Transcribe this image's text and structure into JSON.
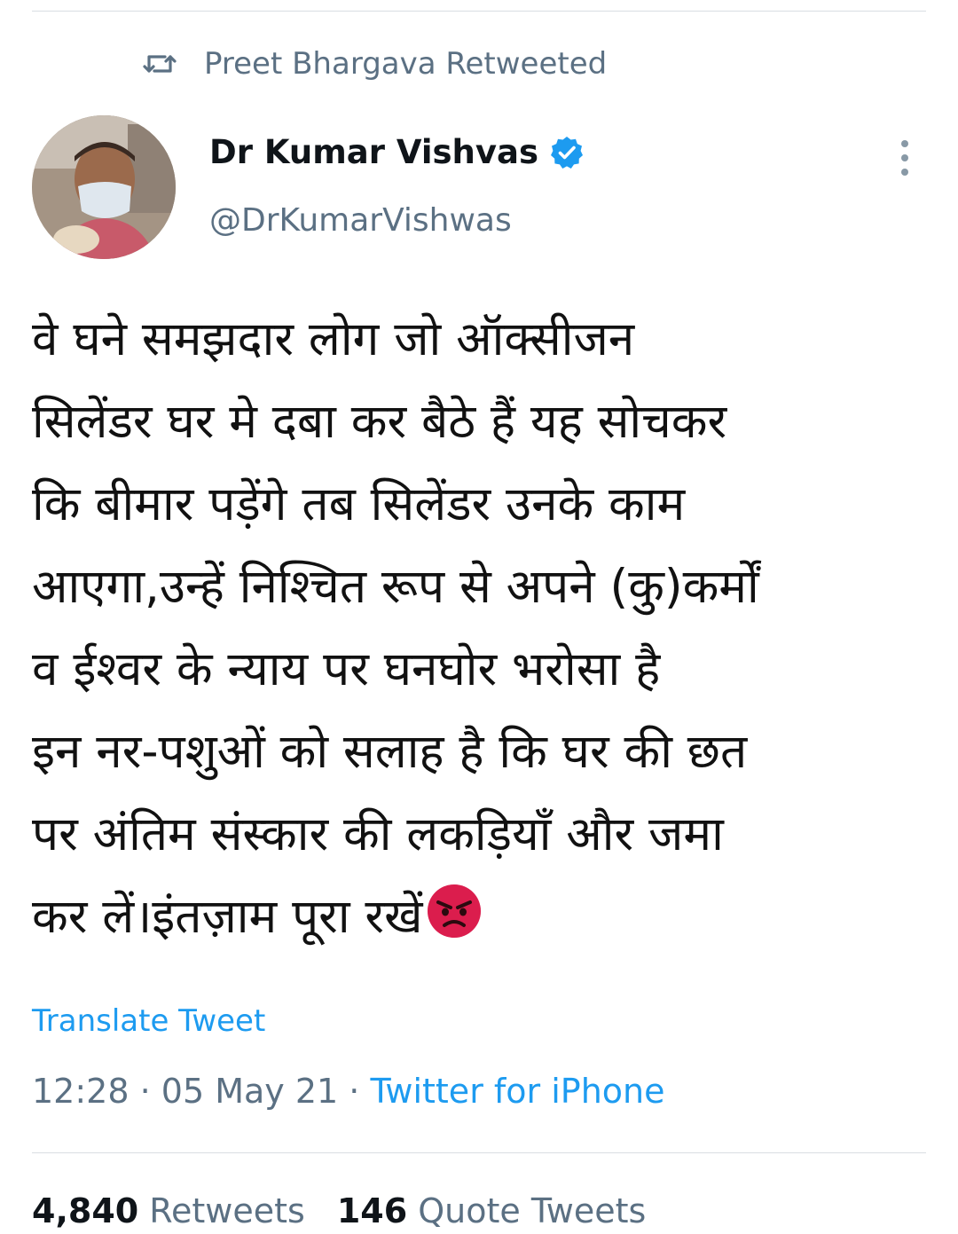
{
  "retweet_banner": {
    "text": "Preet Bhargava Retweeted",
    "icon": "retweet-icon"
  },
  "author": {
    "name": "Dr Kumar Vishvas",
    "handle": "@DrKumarVishwas",
    "verified": true
  },
  "tweet": {
    "lines": [
      "वे घने समझदार लोग जो ऑक्सीजन",
      "सिलेंडर घर मे दबा कर बैठे हैं यह सोचकर",
      "कि बीमार पड़ेंगे तब सिलेंडर उनके काम",
      "आएगा,उन्हें निश्चित रूप से अपने (कु)कर्मों",
      "व ईश्वर के न्याय पर घनघोर भरोसा है",
      "इन नर-पशुओं को सलाह है कि घर की छत",
      "पर अंतिम संस्कार की लकड़ियाँ और जमा",
      "कर लें।इंतज़ाम पूरा रखें"
    ],
    "trailing_emoji": "angry-face-emoji"
  },
  "translate_label": "Translate Tweet",
  "meta": {
    "time": "12:28",
    "separator": " · ",
    "date": "05 May 21",
    "source": "Twitter for iPhone"
  },
  "stats": {
    "retweets_count": "4,840",
    "retweets_label": "Retweets",
    "quotes_count": "146",
    "quotes_label": "Quote Tweets"
  },
  "colors": {
    "accent": "#1d9bf0",
    "secondary_text": "#5b7083",
    "emoji_red": "#e0245e"
  }
}
